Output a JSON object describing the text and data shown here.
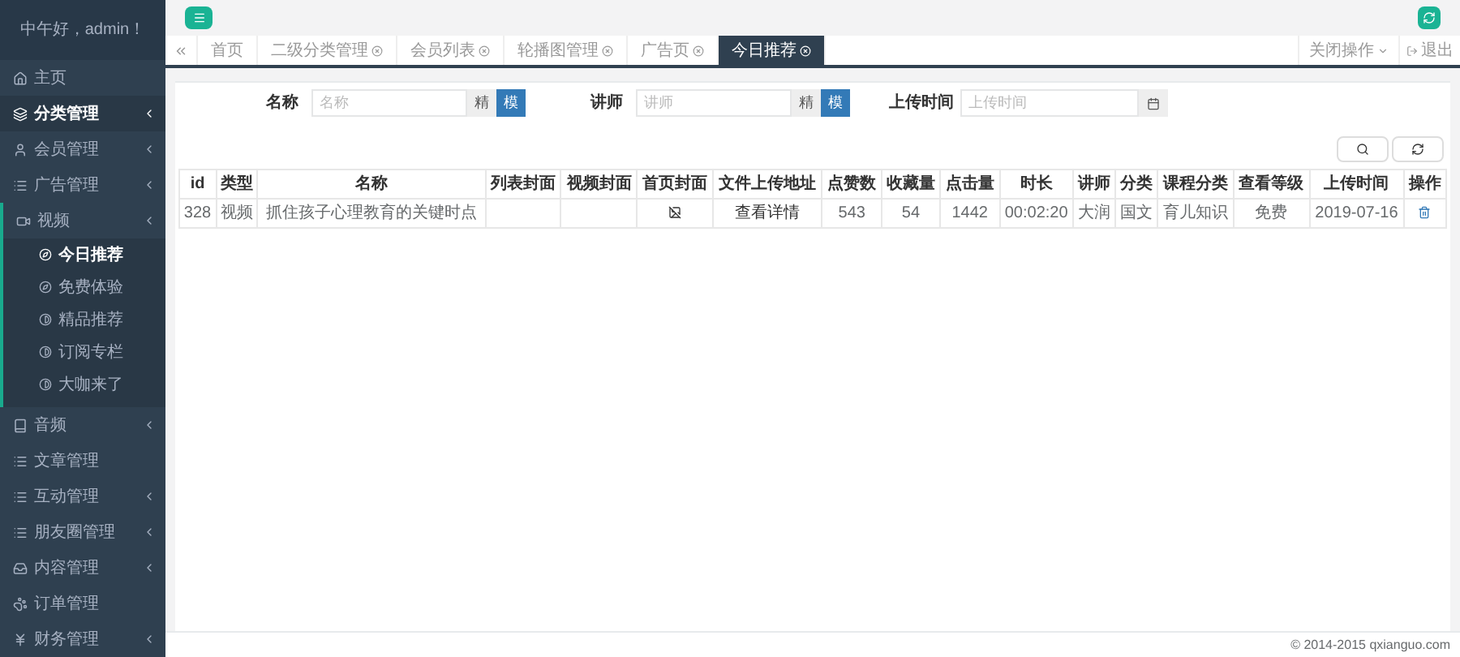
{
  "sidebar": {
    "greeting": "中午好，admin！",
    "items": [
      {
        "label": "主页",
        "selected": false,
        "expandable": false
      },
      {
        "label": "分类管理",
        "selected": true,
        "expandable": true
      },
      {
        "label": "会员管理",
        "selected": false,
        "expandable": true
      },
      {
        "label": "广告管理",
        "selected": false,
        "expandable": true
      },
      {
        "label": "视频",
        "selected": false,
        "expandable": true,
        "expanded": true,
        "children": [
          {
            "label": "今日推荐",
            "selected": true
          },
          {
            "label": "免费体验",
            "selected": false
          },
          {
            "label": "精品推荐",
            "selected": false
          },
          {
            "label": "订阅专栏",
            "selected": false
          },
          {
            "label": "大咖来了",
            "selected": false
          }
        ]
      },
      {
        "label": "音频",
        "selected": false,
        "expandable": true
      },
      {
        "label": "文章管理",
        "selected": false,
        "expandable": false
      },
      {
        "label": "互动管理",
        "selected": false,
        "expandable": true
      },
      {
        "label": "朋友圈管理",
        "selected": false,
        "expandable": true
      },
      {
        "label": "内容管理",
        "selected": false,
        "expandable": true
      },
      {
        "label": "订单管理",
        "selected": false,
        "expandable": false
      },
      {
        "label": "财务管理",
        "selected": false,
        "expandable": true
      }
    ]
  },
  "tabs": [
    {
      "label": "首页",
      "closable": false,
      "selected": false
    },
    {
      "label": "二级分类管理",
      "closable": true,
      "selected": false
    },
    {
      "label": "会员列表",
      "closable": true,
      "selected": false
    },
    {
      "label": "轮播图管理",
      "closable": true,
      "selected": false
    },
    {
      "label": "广告页",
      "closable": true,
      "selected": false
    },
    {
      "label": "今日推荐",
      "closable": true,
      "selected": true
    }
  ],
  "tab_actions": {
    "close_menu": "关闭操作",
    "logout": "退出"
  },
  "filters": [
    {
      "kind": "text",
      "label": "名称",
      "placeholder": "名称",
      "addon": "精",
      "button": "模"
    },
    {
      "kind": "text",
      "label": "讲师",
      "placeholder": "讲师",
      "addon": "精",
      "button": "模"
    },
    {
      "kind": "date",
      "label": "上传时间",
      "placeholder": "上传时间"
    }
  ],
  "table": {
    "columns": [
      "id",
      "类型",
      "名称",
      "列表封面",
      "视频封面",
      "首页封面",
      "文件上传地址",
      "点赞数",
      "收藏量",
      "点击量",
      "时长",
      "讲师",
      "分类",
      "课程分类",
      "查看等级",
      "上传时间",
      "操作"
    ],
    "rows": [
      {
        "cells": [
          "328",
          "视频",
          "抓住孩子心理教育的关键时点",
          "",
          "",
          "",
          "查看详情",
          "543",
          "54",
          "1442",
          "00:02:20",
          "大润",
          "国文",
          "育儿知识",
          "免费",
          "2019-07-16",
          ""
        ]
      }
    ]
  },
  "footer": "© 2014-2015 qxianguo.com"
}
